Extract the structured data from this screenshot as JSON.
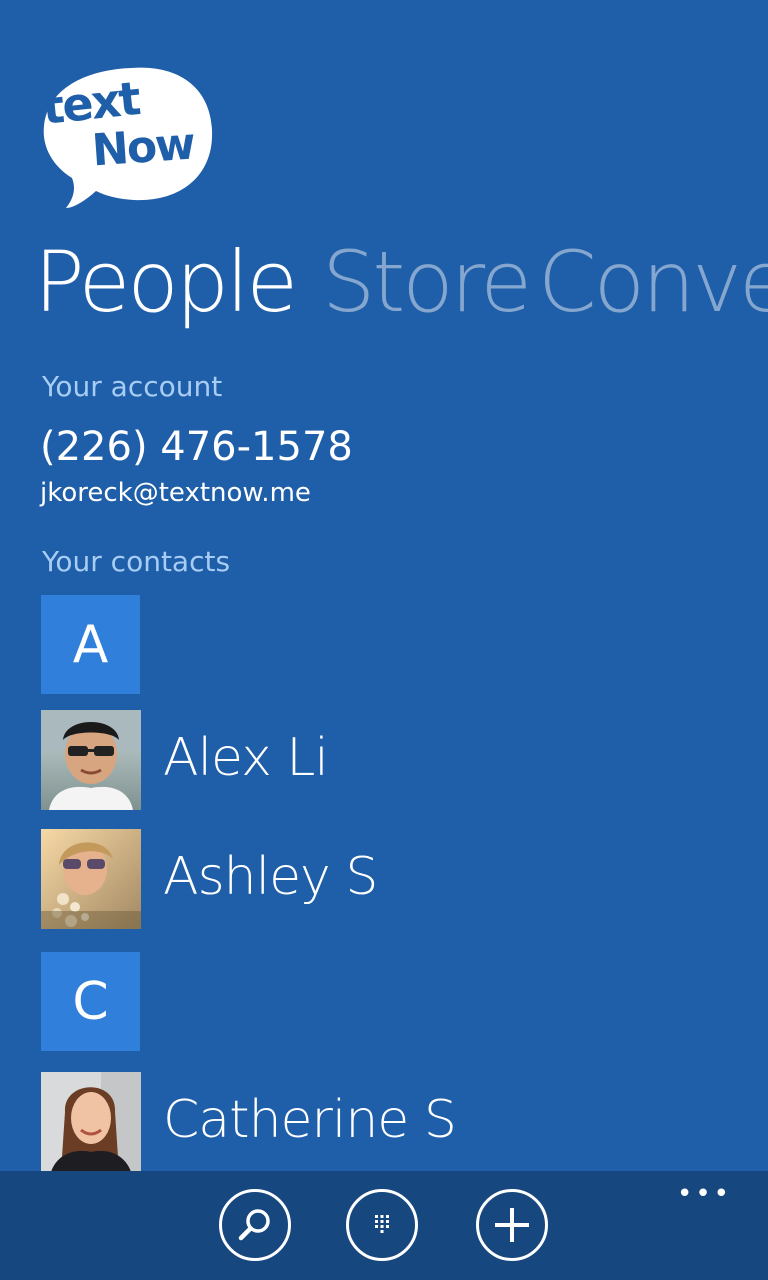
{
  "app": {
    "logo_line1": "text",
    "logo_line2": "Now"
  },
  "pivot": {
    "items": [
      "People",
      "Store",
      "Conve"
    ],
    "active_index": 0
  },
  "account": {
    "label": "Your account",
    "phone": "(226) 476-1578",
    "email": "jkoreck@textnow.me"
  },
  "contacts": {
    "label": "Your contacts",
    "groups": [
      {
        "letter": "A",
        "people": [
          "Alex Li",
          "Ashley S"
        ]
      },
      {
        "letter": "C",
        "people": [
          "Catherine S"
        ]
      }
    ]
  },
  "appbar": {
    "buttons": [
      "search-icon",
      "dialpad-icon",
      "add-icon"
    ],
    "more_label": "•••"
  },
  "colors": {
    "background": "#1f5ea8",
    "tile": "#2f7fdb",
    "appbar": "#17477f",
    "section_label": "#a8cdf4"
  }
}
